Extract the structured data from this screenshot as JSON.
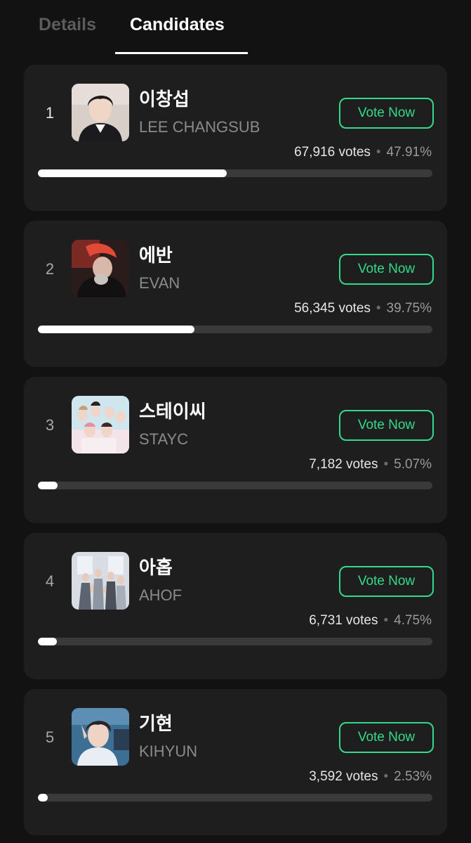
{
  "tabs": [
    {
      "label": "Details",
      "active": false
    },
    {
      "label": "Candidates",
      "active": true
    }
  ],
  "colors": {
    "background": "#121212",
    "card": "#1e1e1e",
    "accent": "#35d98a",
    "bar_fill": "#ffffff",
    "bar_track": "#3a3a3a"
  },
  "vote_button_label": "Vote Now",
  "separator": "•",
  "candidates": [
    {
      "rank": "1",
      "name_ko": "이창섭",
      "name_en": "LEE CHANGSUB",
      "votes": "67,916 votes",
      "percent": "47.91%",
      "share": 47.91,
      "thumbnail_icon": "candidate-photo"
    },
    {
      "rank": "2",
      "name_ko": "에반",
      "name_en": "EVAN",
      "votes": "56,345 votes",
      "percent": "39.75%",
      "share": 39.75,
      "thumbnail_icon": "candidate-photo"
    },
    {
      "rank": "3",
      "name_ko": "스테이씨",
      "name_en": "STAYC",
      "votes": "7,182 votes",
      "percent": "5.07%",
      "share": 5.07,
      "thumbnail_icon": "candidate-photo"
    },
    {
      "rank": "4",
      "name_ko": "아홉",
      "name_en": "AHOF",
      "votes": "6,731 votes",
      "percent": "4.75%",
      "share": 4.75,
      "thumbnail_icon": "candidate-photo"
    },
    {
      "rank": "5",
      "name_ko": "기현",
      "name_en": "KIHYUN",
      "votes": "3,592 votes",
      "percent": "2.53%",
      "share": 2.53,
      "thumbnail_icon": "candidate-photo"
    }
  ]
}
